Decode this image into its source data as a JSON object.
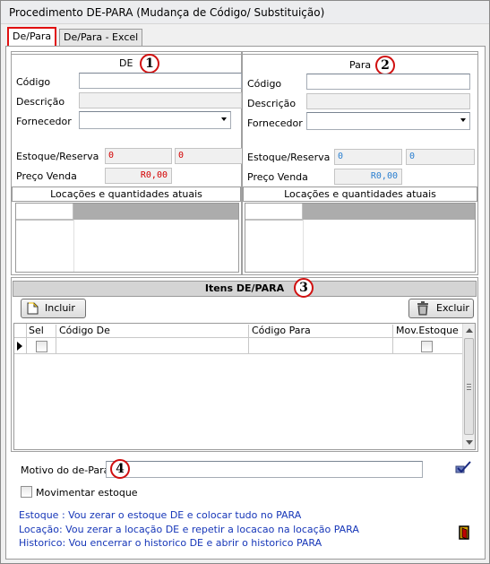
{
  "window": {
    "title": "Procedimento DE-PARA (Mudança de Código/ Substituição)"
  },
  "tabs": [
    {
      "label": "De/Para",
      "active": true
    },
    {
      "label": "De/Para - Excel",
      "active": false
    }
  ],
  "de": {
    "heading": "DE",
    "badge": "1",
    "codigo_label": "Código",
    "codigo_value": "",
    "descricao_label": "Descrição",
    "descricao_value": "",
    "fornecedor_label": "Fornecedor",
    "fornecedor_value": "",
    "estoque_label": "Estoque/Reserva",
    "estoque_value": "0",
    "reserva_value": "0",
    "preco_label": "Preço Venda",
    "preco_value": "R0,00",
    "locacoes_caption": "Locações e quantidades atuais"
  },
  "para": {
    "heading": "Para",
    "badge": "2",
    "codigo_label": "Código",
    "codigo_value": "",
    "descricao_label": "Descrição",
    "descricao_value": "",
    "fornecedor_label": "Fornecedor",
    "fornecedor_value": "",
    "estoque_label": "Estoque/Reserva",
    "estoque_value": "0",
    "reserva_value": "0",
    "preco_label": "Preço Venda",
    "preco_value": "R0,00",
    "locacoes_caption": "Locações e quantidades atuais"
  },
  "itens": {
    "caption": "Itens DE/PARA",
    "badge": "3",
    "incluir_label": "Incluir",
    "excluir_label": "Excluir",
    "columns": [
      "Sel",
      "Código De",
      "Código Para",
      "Mov.Estoque"
    ],
    "rows": [
      {
        "sel": false,
        "codigo_de": "",
        "codigo_para": "",
        "mov_estoque": false
      }
    ]
  },
  "motivo": {
    "label": "Motivo do de-Para",
    "value": "",
    "badge": "4"
  },
  "movimentar": {
    "label": "Movimentar estoque",
    "checked": false
  },
  "info_lines": [
    "Estoque : Vou zerar o estoque DE e colocar tudo no PARA",
    "Locação: Vou zerar a locação  DE e repetir a locacao na locação PARA",
    "Historico: Vou encerrar o historico DE e abrir o historico PARA"
  ],
  "colors": {
    "badge_border": "#d01010",
    "info_text": "#1636b8",
    "de_values": "#d40000",
    "para_values": "#2a7fd0"
  }
}
